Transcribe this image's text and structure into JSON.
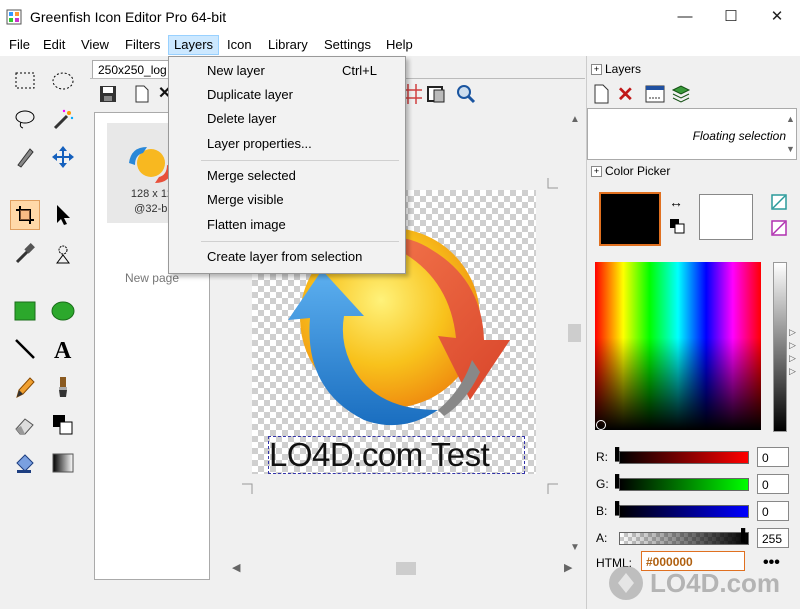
{
  "window": {
    "title": "Greenfish Icon Editor Pro 64-bit",
    "minimize": "—",
    "maximize": "☐",
    "close": "✕"
  },
  "menu": [
    "File",
    "Edit",
    "View",
    "Filters",
    "Layers",
    "Icon",
    "Library",
    "Settings",
    "Help"
  ],
  "active_menu": "Layers",
  "layers_menu": {
    "items": [
      {
        "label": "New layer",
        "shortcut": "Ctrl+L"
      },
      {
        "label": "Duplicate layer",
        "shortcut": ""
      },
      {
        "label": "Delete layer",
        "shortcut": ""
      },
      {
        "label": "Layer properties...",
        "shortcut": ""
      },
      {
        "label": "Merge selected",
        "shortcut": ""
      },
      {
        "label": "Merge visible",
        "shortcut": ""
      },
      {
        "label": "Flatten image",
        "shortcut": ""
      },
      {
        "label": "Create layer from selection",
        "shortcut": ""
      }
    ]
  },
  "document": {
    "tab_label": "250x250_log",
    "thumb_line1": "128 x 12",
    "thumb_line2": "@32-bi",
    "new_page": "New page",
    "canvas_text": "LO4D.com Test"
  },
  "right_panel": {
    "layers_title": "Layers",
    "layer_item": "Floating selection",
    "color_picker_title": "Color Picker",
    "sliders": [
      {
        "label": "R:",
        "value": "0"
      },
      {
        "label": "G:",
        "value": "0"
      },
      {
        "label": "B:",
        "value": "0"
      },
      {
        "label": "A:",
        "value": "255"
      }
    ],
    "html_label": "HTML:",
    "html_value": "#000000",
    "more": "•••"
  },
  "colors": {
    "primary": "#000000",
    "secondary": "#ffffff",
    "accent": "#e07020",
    "menu_highlight": "#cce8ff"
  },
  "watermark": "LO4D.com"
}
